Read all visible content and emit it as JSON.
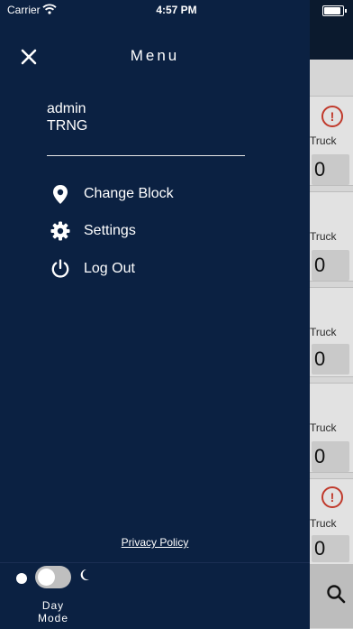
{
  "status_bar": {
    "carrier": "Carrier",
    "time": "4:57 PM"
  },
  "menu": {
    "title": "Menu",
    "user_name": "admin",
    "user_org": "TRNG",
    "items": [
      {
        "label": "Change Block",
        "icon": "location-pin-icon"
      },
      {
        "label": "Settings",
        "icon": "gear-icon"
      },
      {
        "label": "Log Out",
        "icon": "power-icon"
      }
    ],
    "privacy_link": "Privacy Policy",
    "mode_toggle": {
      "line1": "Day",
      "line2": "Mode",
      "enabled": false
    }
  },
  "background_cards": [
    {
      "label": "Truck",
      "value": "0",
      "alert": true
    },
    {
      "label": "Truck",
      "value": "0",
      "alert": false
    },
    {
      "label": "Truck",
      "value": "0",
      "alert": false
    },
    {
      "label": "Truck",
      "value": "0",
      "alert": false
    },
    {
      "label": "Truck",
      "value": "0",
      "alert": true
    }
  ],
  "colors": {
    "drawer_bg": "#0b2142",
    "alert": "#c0392b",
    "text": "#ffffff"
  }
}
